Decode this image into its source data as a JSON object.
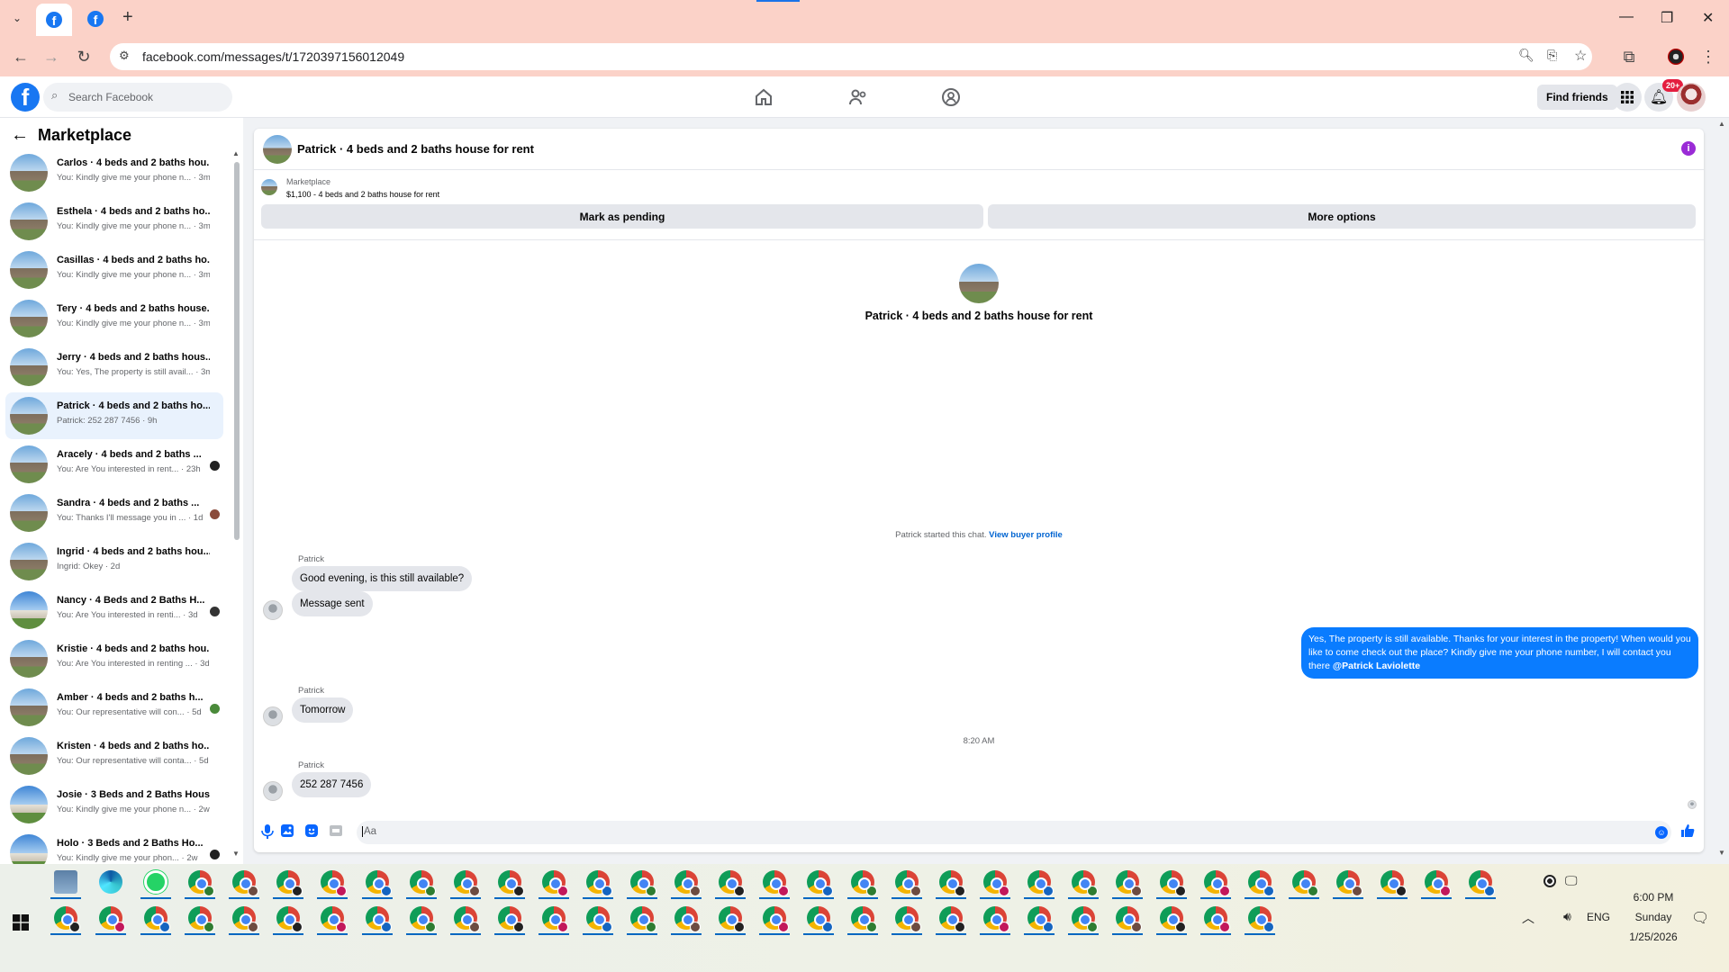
{
  "browser": {
    "url": "facebook.com/messages/t/1720397156012049",
    "tabs": [
      {
        "label": "Facebook"
      },
      {
        "label": "Facebook"
      }
    ],
    "new_tab_label": "+"
  },
  "fb": {
    "search_placeholder": "Search Facebook",
    "find_friends": "Find friends",
    "notification_badge": "20+"
  },
  "sidebar": {
    "title": "Marketplace",
    "conversations": [
      {
        "name": "Carlos · 4 beds and 2 baths hou...",
        "preview": "You: Kindly give me your phone n... · 3m",
        "active": false
      },
      {
        "name": "Esthela · 4 beds and 2 baths ho...",
        "preview": "You: Kindly give me your phone n... · 3m",
        "active": false
      },
      {
        "name": "Casillas · 4 beds and 2 baths ho...",
        "preview": "You: Kindly give me your phone n... · 3m",
        "active": false
      },
      {
        "name": "Tery · 4 beds and 2 baths house...",
        "preview": "You: Kindly give me your phone n... · 3m",
        "active": false
      },
      {
        "name": "Jerry · 4 beds and 2 baths hous...",
        "preview": "You: Yes, The property is still avail... · 3m",
        "active": false
      },
      {
        "name": "Patrick · 4 beds and 2 baths ho...",
        "preview": "Patrick: 252 287 7456 · 9h",
        "active": true
      },
      {
        "name": "Aracely · 4 beds and 2 baths ...",
        "preview": "You: Are You interested in rent... · 23h",
        "active": false
      },
      {
        "name": "Sandra · 4 beds and 2 baths ...",
        "preview": "You: Thanks I'll message you in ... · 1d",
        "active": false
      },
      {
        "name": "Ingrid · 4 beds and 2 baths hou...",
        "preview": "Ingrid: Okey · 2d",
        "active": false
      },
      {
        "name": "Nancy · 4 Beds and 2 Baths H...",
        "preview": "You: Are You interested in renti... · 3d",
        "active": false
      },
      {
        "name": "Kristie · 4 beds and 2 baths hou...",
        "preview": "You: Are You interested in renting ... · 3d",
        "active": false
      },
      {
        "name": "Amber · 4 beds and 2 baths h...",
        "preview": "You: Our representative will con... · 5d",
        "active": false
      },
      {
        "name": "Kristen · 4 beds and 2 baths ho...",
        "preview": "You: Our representative will conta... · 5d",
        "active": false
      },
      {
        "name": "Josie · 3 Beds and 2 Baths Hous...",
        "preview": "You: Kindly give me your phone n... · 2w",
        "active": false
      },
      {
        "name": "Holo · 3 Beds and 2 Baths Ho...",
        "preview": "You: Kindly give me your phon... · 2w",
        "active": false
      }
    ]
  },
  "chat": {
    "header_title": "Patrick · 4 beds and 2 baths house for rent",
    "listing_source": "Marketplace",
    "listing_title": "$1,100 - 4 beds and 2 baths house for rent",
    "mark_pending": "Mark as pending",
    "more_options": "More options",
    "intro_title": "Patrick · 4 beds and 2 baths house for rent",
    "started_text": "Patrick started this chat.",
    "view_buyer_profile": "View buyer profile",
    "messages": {
      "sender_1": "Patrick",
      "msg_1": "Good evening, is this still available?",
      "msg_2": "Message sent",
      "outgoing_text": "Yes, The property is still available. Thanks for your interest in the property! When would you like to come check out the place? Kindly give me your phone number, I will contact you there",
      "outgoing_mention": "@Patrick Laviolette",
      "sender_2": "Patrick",
      "msg_3": "Tomorrow",
      "timestamp": "8:20 AM",
      "sender_3": "Patrick",
      "msg_4": "252 287 7456"
    },
    "composer_placeholder": "Aa"
  },
  "taskbar": {
    "time": "6:00 PM",
    "day": "Sunday",
    "date": "1/25/2026",
    "language": "ENG"
  },
  "colors": {
    "accent": "#1877f2",
    "outgoing_bubble": "#0a7cff",
    "info_icon": "#9a2bd6",
    "browser_frame": "#fbd2c8"
  }
}
